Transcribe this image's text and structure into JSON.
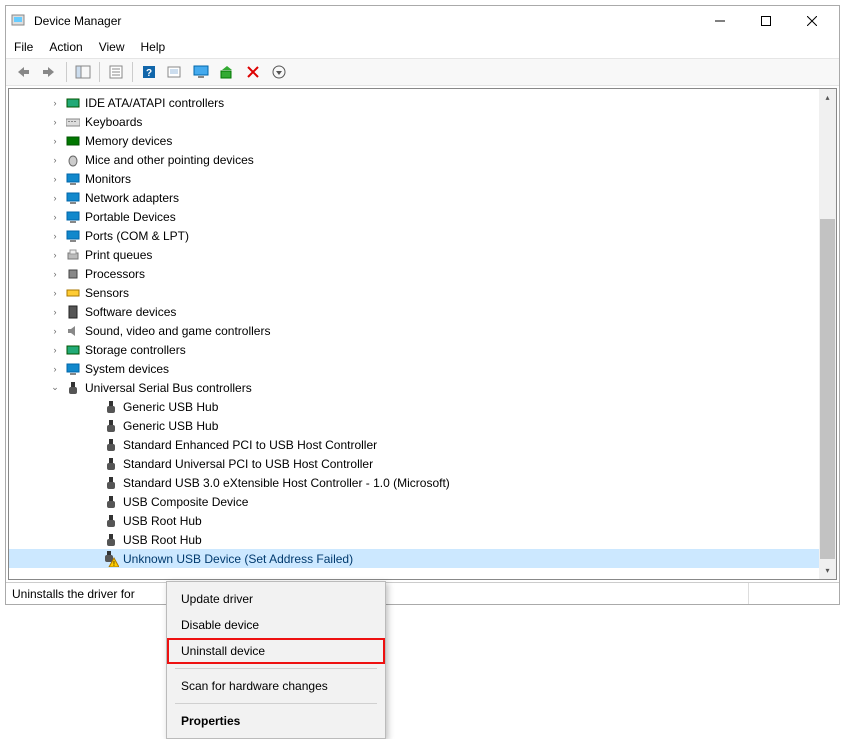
{
  "window": {
    "title": "Device Manager",
    "controls": {
      "min": "–",
      "max": "☐",
      "close": "✕"
    }
  },
  "menu": [
    "File",
    "Action",
    "View",
    "Help"
  ],
  "toolbar_icons": [
    "back",
    "forward",
    "show-panel",
    "properties",
    "help",
    "scan",
    "display",
    "enable",
    "delete",
    "more"
  ],
  "tree": [
    {
      "label": "IDE ATA/ATAPI controllers",
      "icon": "ide",
      "expand": "right"
    },
    {
      "label": "Keyboards",
      "icon": "keyboard",
      "expand": "right"
    },
    {
      "label": "Memory devices",
      "icon": "memory",
      "expand": "right"
    },
    {
      "label": "Mice and other pointing devices",
      "icon": "mouse",
      "expand": "right"
    },
    {
      "label": "Monitors",
      "icon": "monitor",
      "expand": "right"
    },
    {
      "label": "Network adapters",
      "icon": "network",
      "expand": "right"
    },
    {
      "label": "Portable Devices",
      "icon": "portable",
      "expand": "right"
    },
    {
      "label": "Ports (COM & LPT)",
      "icon": "port",
      "expand": "right"
    },
    {
      "label": "Print queues",
      "icon": "printer",
      "expand": "right"
    },
    {
      "label": "Processors",
      "icon": "cpu",
      "expand": "right"
    },
    {
      "label": "Sensors",
      "icon": "sensor",
      "expand": "right"
    },
    {
      "label": "Software devices",
      "icon": "software",
      "expand": "right"
    },
    {
      "label": "Sound, video and game controllers",
      "icon": "sound",
      "expand": "right"
    },
    {
      "label": "Storage controllers",
      "icon": "storage",
      "expand": "right"
    },
    {
      "label": "System devices",
      "icon": "system",
      "expand": "right"
    },
    {
      "label": "Universal Serial Bus controllers",
      "icon": "usb",
      "expand": "down",
      "children": [
        {
          "label": "Generic USB Hub",
          "icon": "usb-conn"
        },
        {
          "label": "Generic USB Hub",
          "icon": "usb-conn"
        },
        {
          "label": "Standard Enhanced PCI to USB Host Controller",
          "icon": "usb-conn"
        },
        {
          "label": "Standard Universal PCI to USB Host Controller",
          "icon": "usb-conn"
        },
        {
          "label": "Standard USB 3.0 eXtensible Host Controller - 1.0 (Microsoft)",
          "icon": "usb-conn"
        },
        {
          "label": "USB Composite Device",
          "icon": "usb-conn"
        },
        {
          "label": "USB Root Hub",
          "icon": "usb-conn"
        },
        {
          "label": "USB Root Hub",
          "icon": "usb-conn"
        },
        {
          "label": "Unknown USB Device (Set Address Failed)",
          "icon": "usb-warn",
          "selected": true
        }
      ]
    }
  ],
  "statusbar": "Uninstalls the driver for",
  "context_menu": [
    {
      "label": "Update driver",
      "kind": "item"
    },
    {
      "label": "Disable device",
      "kind": "item"
    },
    {
      "label": "Uninstall device",
      "kind": "item",
      "highlight": true
    },
    {
      "kind": "sep"
    },
    {
      "label": "Scan for hardware changes",
      "kind": "item"
    },
    {
      "kind": "sep"
    },
    {
      "label": "Properties",
      "kind": "item",
      "bold": true
    }
  ],
  "icons": {
    "ide": "#2a7",
    "keyboard": "#888",
    "memory": "#070",
    "mouse": "#555",
    "monitor": "#18c",
    "network": "#18c",
    "portable": "#18c",
    "port": "#18c",
    "printer": "#888",
    "cpu": "#555",
    "sensor": "#fb0",
    "software": "#333",
    "sound": "#888",
    "storage": "#2a7",
    "system": "#18c",
    "usb": "#333",
    "usb-conn": "#333",
    "usb-warn": "#333"
  }
}
